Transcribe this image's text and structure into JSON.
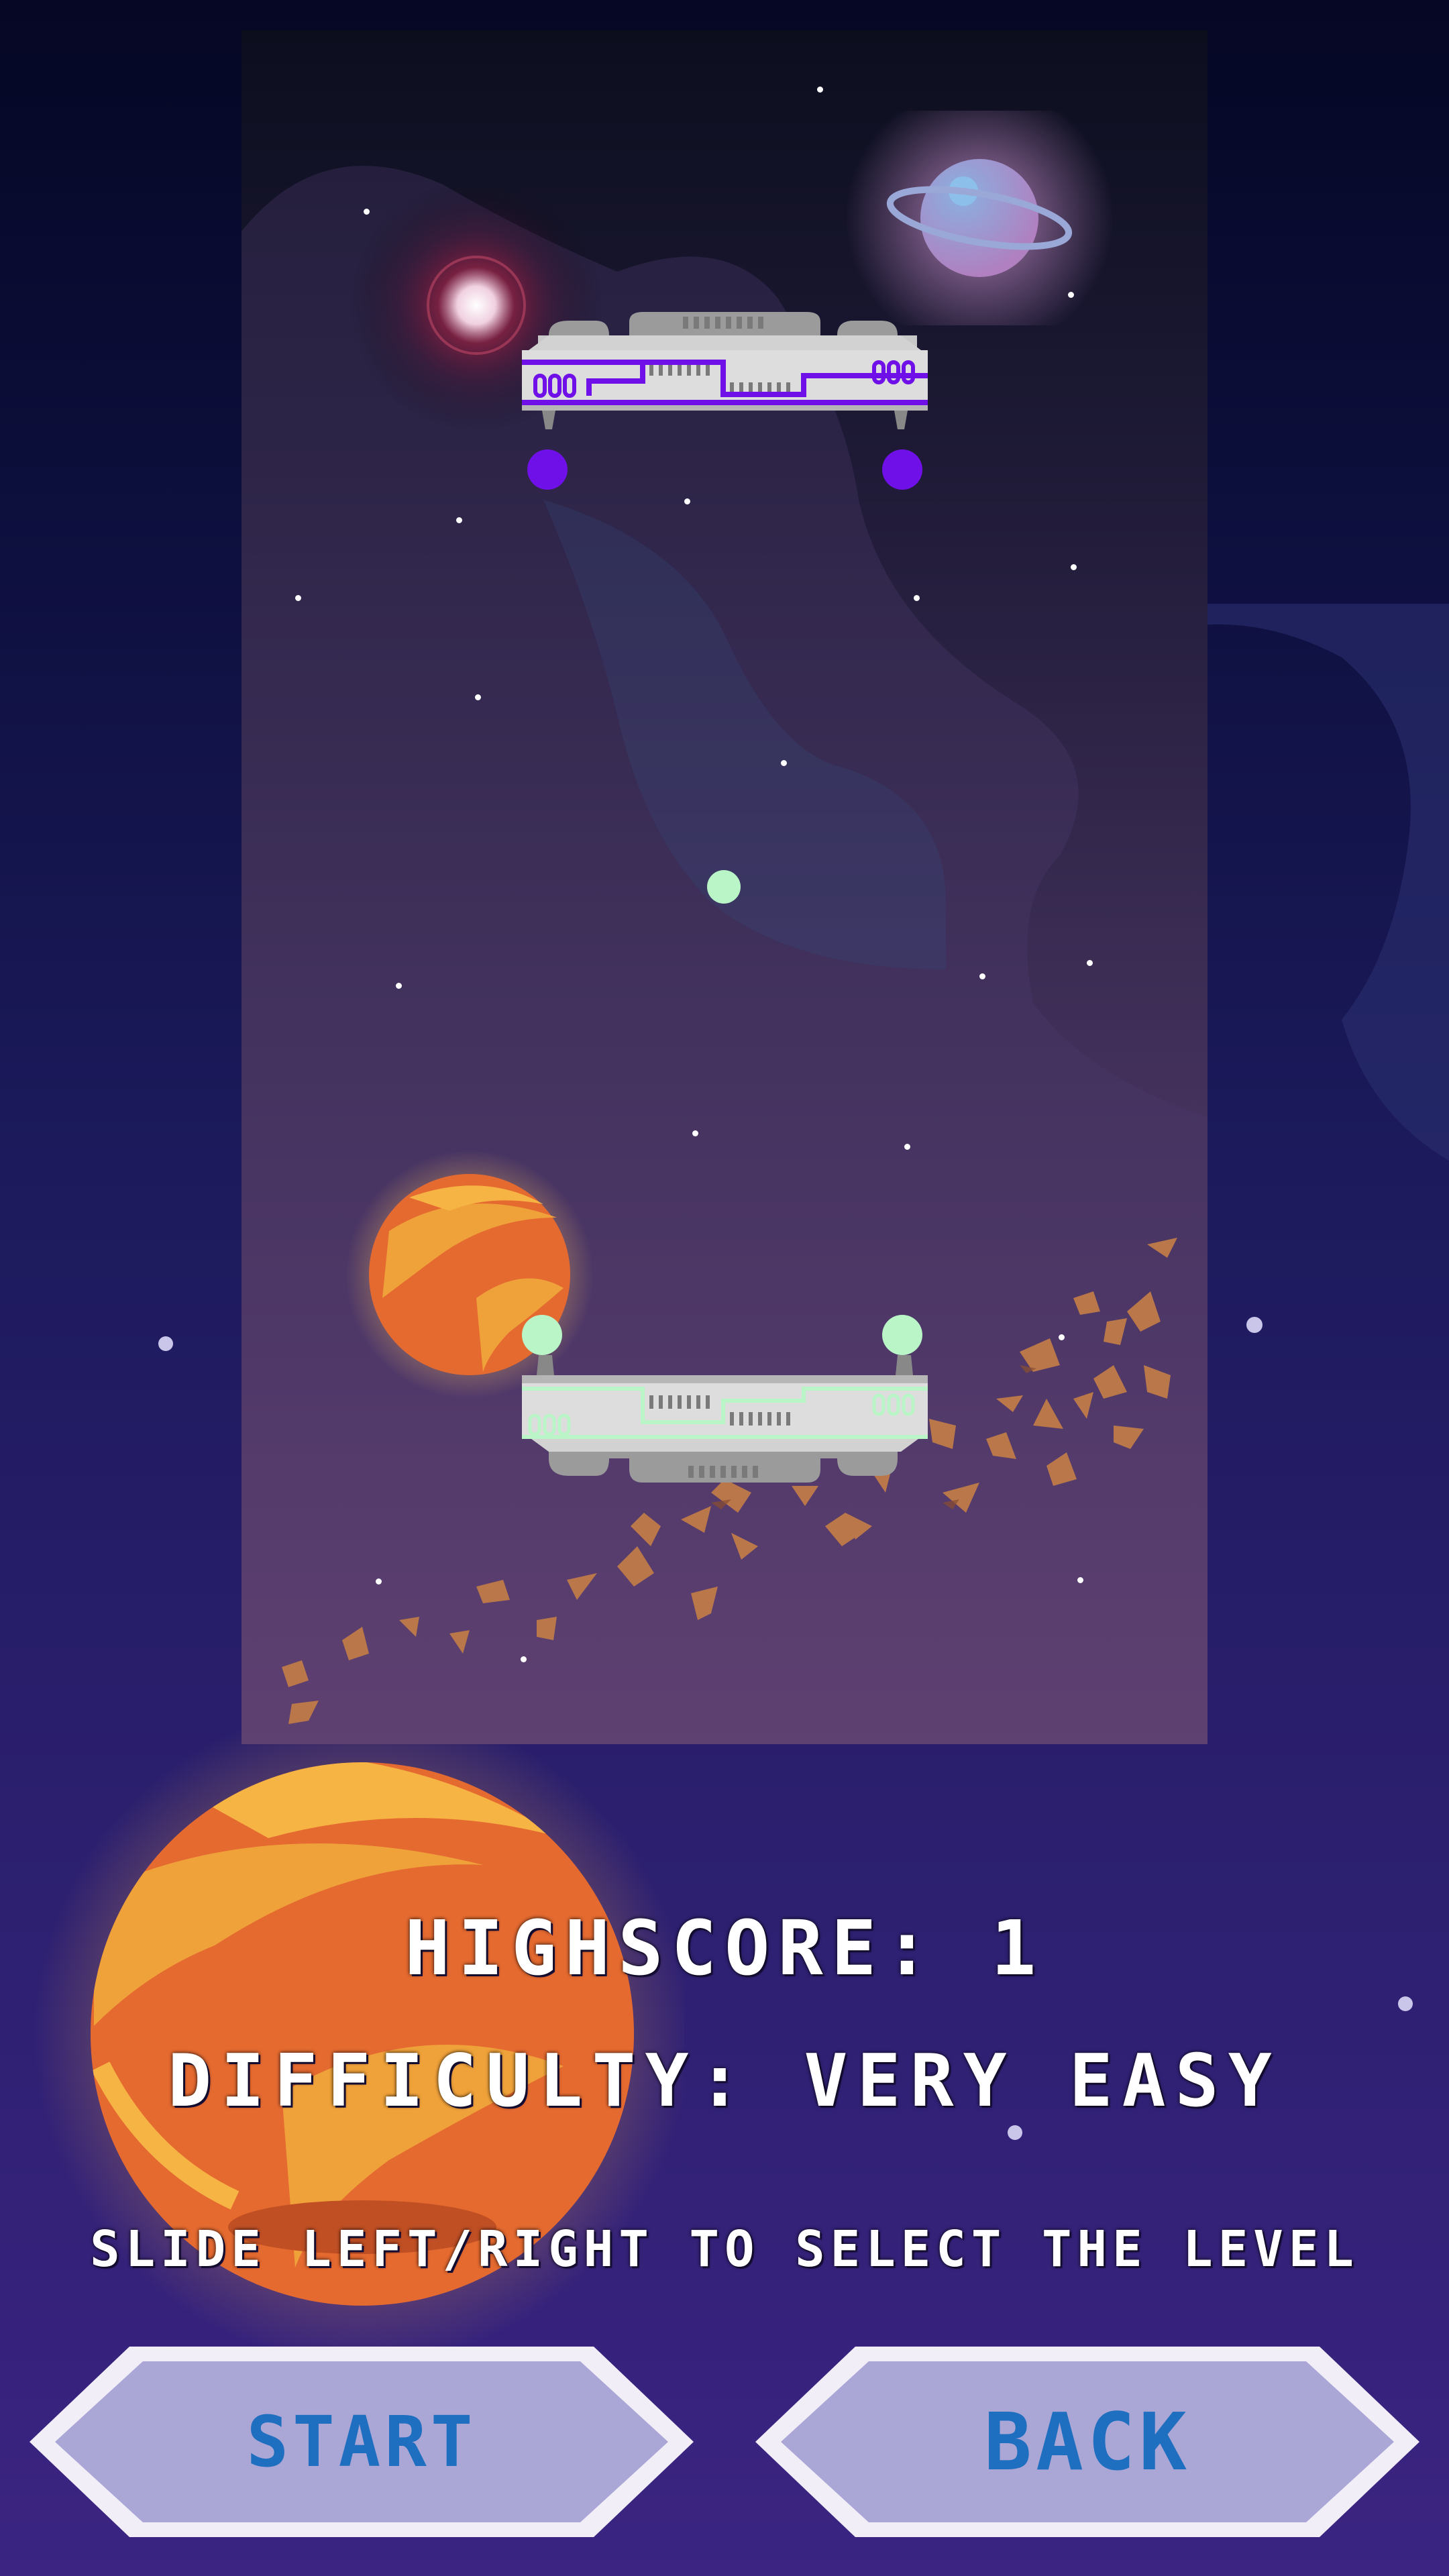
{
  "menu": {
    "highscore_text": "HIGHSCORE: 1",
    "difficulty_text": "DIFFICULTY: VERY EASY",
    "instruction_text": "SLIDE LEFT/RIGHT TO SELECT THE LEVEL",
    "start_label": "START",
    "back_label": "BACK"
  },
  "theme": {
    "button_fill": "#aaa6d6",
    "button_border": "#f1eef8",
    "button_text": "#1f6fc0",
    "top_paddle_accent": "#7010e8",
    "bottom_paddle_accent": "#b9f5c6",
    "ball_color": "#b9f5c6"
  },
  "game_preview": {
    "top_paddle": "opponent-paddle",
    "bottom_paddle": "player-paddle",
    "ball": "ball",
    "decor": [
      "ringed-planet-icon",
      "orange-planet-icon",
      "bright-star-icon",
      "asteroid-field"
    ]
  }
}
